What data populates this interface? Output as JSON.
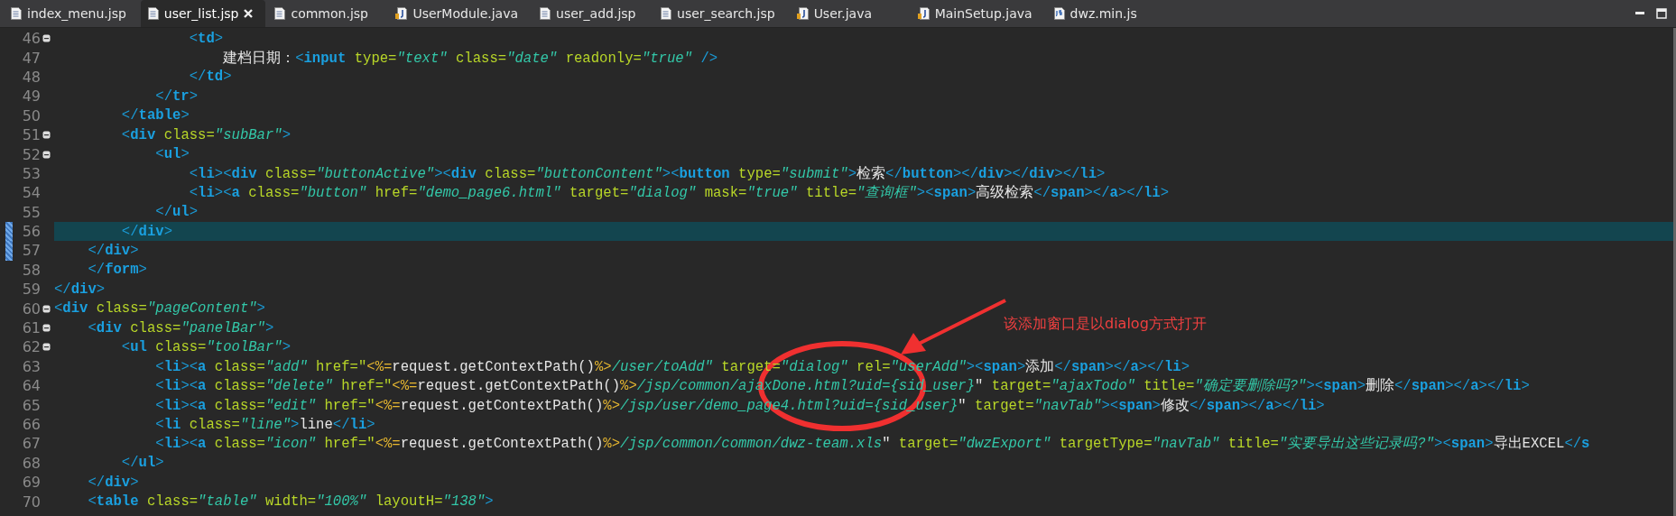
{
  "tabs": [
    {
      "label": "index_menu.jsp",
      "kind": "jsp",
      "selected": false
    },
    {
      "label": "user_list.jsp",
      "kind": "jsp",
      "selected": true
    },
    {
      "label": "common.jsp",
      "kind": "jsp",
      "selected": false
    },
    {
      "label": "UserModule.java",
      "kind": "java",
      "selected": false
    },
    {
      "label": "user_add.jsp",
      "kind": "jsp",
      "selected": false
    },
    {
      "label": "user_search.jsp",
      "kind": "jsp",
      "selected": false
    },
    {
      "label": "User.java",
      "kind": "java",
      "selected": false
    },
    {
      "label": "MainSetup.java",
      "kind": "java",
      "selected": false
    },
    {
      "label": "dwz.min.js",
      "kind": "js",
      "selected": false
    }
  ],
  "lines": [
    {
      "number": "46",
      "foldable": true,
      "current": false,
      "changed": false,
      "tokens": [
        {
          "kind": "p",
          "text": "                <"
        },
        {
          "kind": "t",
          "text": "td"
        },
        {
          "kind": "p",
          "text": ">"
        }
      ]
    },
    {
      "number": "47",
      "foldable": false,
      "current": false,
      "changed": false,
      "tokens": [
        {
          "kind": "x",
          "text": "                    建档日期："
        },
        {
          "kind": "p",
          "text": "<"
        },
        {
          "kind": "t",
          "text": "input"
        },
        {
          "kind": "a",
          "text": " type="
        },
        {
          "kind": "s",
          "text": "\"text\""
        },
        {
          "kind": "a",
          "text": " class="
        },
        {
          "kind": "s",
          "text": "\"date\""
        },
        {
          "kind": "a",
          "text": " readonly="
        },
        {
          "kind": "s",
          "text": "\"true\""
        },
        {
          "kind": "p",
          "text": " />"
        }
      ]
    },
    {
      "number": "48",
      "foldable": false,
      "current": false,
      "changed": false,
      "tokens": [
        {
          "kind": "p",
          "text": "                </"
        },
        {
          "kind": "t",
          "text": "td"
        },
        {
          "kind": "p",
          "text": ">"
        }
      ]
    },
    {
      "number": "49",
      "foldable": false,
      "current": false,
      "changed": false,
      "tokens": [
        {
          "kind": "p",
          "text": "            </"
        },
        {
          "kind": "t",
          "text": "tr"
        },
        {
          "kind": "p",
          "text": ">"
        }
      ]
    },
    {
      "number": "50",
      "foldable": false,
      "current": false,
      "changed": false,
      "tokens": [
        {
          "kind": "p",
          "text": "        </"
        },
        {
          "kind": "t",
          "text": "table"
        },
        {
          "kind": "p",
          "text": ">"
        }
      ]
    },
    {
      "number": "51",
      "foldable": true,
      "current": false,
      "changed": false,
      "tokens": [
        {
          "kind": "p",
          "text": "        <"
        },
        {
          "kind": "t",
          "text": "div"
        },
        {
          "kind": "a",
          "text": " class="
        },
        {
          "kind": "s",
          "text": "\"subBar\""
        },
        {
          "kind": "p",
          "text": ">"
        }
      ]
    },
    {
      "number": "52",
      "foldable": true,
      "current": false,
      "changed": false,
      "tokens": [
        {
          "kind": "p",
          "text": "            <"
        },
        {
          "kind": "t",
          "text": "ul"
        },
        {
          "kind": "p",
          "text": ">"
        }
      ]
    },
    {
      "number": "53",
      "foldable": false,
      "current": false,
      "changed": false,
      "tokens": [
        {
          "kind": "p",
          "text": "                <"
        },
        {
          "kind": "t",
          "text": "li"
        },
        {
          "kind": "p",
          "text": "><"
        },
        {
          "kind": "t",
          "text": "div"
        },
        {
          "kind": "a",
          "text": " class="
        },
        {
          "kind": "s",
          "text": "\"buttonActive\""
        },
        {
          "kind": "p",
          "text": "><"
        },
        {
          "kind": "t",
          "text": "div"
        },
        {
          "kind": "a",
          "text": " class="
        },
        {
          "kind": "s",
          "text": "\"buttonContent\""
        },
        {
          "kind": "p",
          "text": "><"
        },
        {
          "kind": "t",
          "text": "button"
        },
        {
          "kind": "a",
          "text": " type="
        },
        {
          "kind": "s",
          "text": "\"submit\""
        },
        {
          "kind": "p",
          "text": ">"
        },
        {
          "kind": "x",
          "text": "检索"
        },
        {
          "kind": "p",
          "text": "</"
        },
        {
          "kind": "t",
          "text": "button"
        },
        {
          "kind": "p",
          "text": "></"
        },
        {
          "kind": "t",
          "text": "div"
        },
        {
          "kind": "p",
          "text": "></"
        },
        {
          "kind": "t",
          "text": "div"
        },
        {
          "kind": "p",
          "text": "></"
        },
        {
          "kind": "t",
          "text": "li"
        },
        {
          "kind": "p",
          "text": ">"
        }
      ]
    },
    {
      "number": "54",
      "foldable": false,
      "current": false,
      "changed": false,
      "tokens": [
        {
          "kind": "p",
          "text": "                <"
        },
        {
          "kind": "t",
          "text": "li"
        },
        {
          "kind": "p",
          "text": "><"
        },
        {
          "kind": "t",
          "text": "a"
        },
        {
          "kind": "a",
          "text": " class="
        },
        {
          "kind": "s",
          "text": "\"button\""
        },
        {
          "kind": "a",
          "text": " href="
        },
        {
          "kind": "s",
          "text": "\"demo_page6.html\""
        },
        {
          "kind": "a",
          "text": " target="
        },
        {
          "kind": "s",
          "text": "\"dialog\""
        },
        {
          "kind": "a",
          "text": " mask="
        },
        {
          "kind": "s",
          "text": "\"true\""
        },
        {
          "kind": "a",
          "text": " title="
        },
        {
          "kind": "s",
          "text": "\"查询框\""
        },
        {
          "kind": "p",
          "text": "><"
        },
        {
          "kind": "t",
          "text": "span"
        },
        {
          "kind": "p",
          "text": ">"
        },
        {
          "kind": "x",
          "text": "高级检索"
        },
        {
          "kind": "p",
          "text": "</"
        },
        {
          "kind": "t",
          "text": "span"
        },
        {
          "kind": "p",
          "text": "></"
        },
        {
          "kind": "t",
          "text": "a"
        },
        {
          "kind": "p",
          "text": "></"
        },
        {
          "kind": "t",
          "text": "li"
        },
        {
          "kind": "p",
          "text": ">"
        }
      ]
    },
    {
      "number": "55",
      "foldable": false,
      "current": false,
      "changed": false,
      "tokens": [
        {
          "kind": "p",
          "text": "            </"
        },
        {
          "kind": "t",
          "text": "ul"
        },
        {
          "kind": "p",
          "text": ">"
        }
      ]
    },
    {
      "number": "56",
      "foldable": false,
      "current": true,
      "changed": true,
      "tokens": [
        {
          "kind": "p",
          "text": "        </"
        },
        {
          "kind": "t",
          "text": "div"
        },
        {
          "kind": "p",
          "text": ">"
        }
      ]
    },
    {
      "number": "57",
      "foldable": false,
      "current": false,
      "changed": true,
      "tokens": [
        {
          "kind": "p",
          "text": "    </"
        },
        {
          "kind": "t",
          "text": "div"
        },
        {
          "kind": "p",
          "text": ">"
        }
      ]
    },
    {
      "number": "58",
      "foldable": false,
      "current": false,
      "changed": false,
      "tokens": [
        {
          "kind": "p",
          "text": "    </"
        },
        {
          "kind": "t",
          "text": "form"
        },
        {
          "kind": "p",
          "text": ">"
        }
      ]
    },
    {
      "number": "59",
      "foldable": false,
      "current": false,
      "changed": false,
      "tokens": [
        {
          "kind": "p",
          "text": "</"
        },
        {
          "kind": "t",
          "text": "div"
        },
        {
          "kind": "p",
          "text": ">"
        }
      ]
    },
    {
      "number": "60",
      "foldable": true,
      "current": false,
      "changed": false,
      "tokens": [
        {
          "kind": "p",
          "text": "<"
        },
        {
          "kind": "t",
          "text": "div"
        },
        {
          "kind": "a",
          "text": " class="
        },
        {
          "kind": "s",
          "text": "\"pageContent\""
        },
        {
          "kind": "p",
          "text": ">"
        }
      ]
    },
    {
      "number": "61",
      "foldable": true,
      "current": false,
      "changed": false,
      "tokens": [
        {
          "kind": "p",
          "text": "    <"
        },
        {
          "kind": "t",
          "text": "div"
        },
        {
          "kind": "a",
          "text": " class="
        },
        {
          "kind": "s",
          "text": "\"panelBar\""
        },
        {
          "kind": "p",
          "text": ">"
        }
      ]
    },
    {
      "number": "62",
      "foldable": true,
      "current": false,
      "changed": false,
      "tokens": [
        {
          "kind": "p",
          "text": "        <"
        },
        {
          "kind": "t",
          "text": "ul"
        },
        {
          "kind": "a",
          "text": " class="
        },
        {
          "kind": "s",
          "text": "\"toolBar\""
        },
        {
          "kind": "p",
          "text": ">"
        }
      ]
    },
    {
      "number": "63",
      "foldable": false,
      "current": false,
      "changed": false,
      "tokens": [
        {
          "kind": "p",
          "text": "            <"
        },
        {
          "kind": "t",
          "text": "li"
        },
        {
          "kind": "p",
          "text": "><"
        },
        {
          "kind": "t",
          "text": "a"
        },
        {
          "kind": "a",
          "text": " class="
        },
        {
          "kind": "s",
          "text": "\"add\""
        },
        {
          "kind": "a",
          "text": " href=\""
        },
        {
          "kind": "j",
          "text": "<%="
        },
        {
          "kind": "x",
          "text": "request.getContextPath()"
        },
        {
          "kind": "j",
          "text": "%>"
        },
        {
          "kind": "s",
          "text": "/user/toAdd\""
        },
        {
          "kind": "a",
          "text": " target="
        },
        {
          "kind": "s",
          "text": "\"dialog\""
        },
        {
          "kind": "a",
          "text": " rel="
        },
        {
          "kind": "s",
          "text": "\"userAdd\""
        },
        {
          "kind": "p",
          "text": "><"
        },
        {
          "kind": "t",
          "text": "span"
        },
        {
          "kind": "p",
          "text": ">"
        },
        {
          "kind": "x",
          "text": "添加"
        },
        {
          "kind": "p",
          "text": "</"
        },
        {
          "kind": "t",
          "text": "span"
        },
        {
          "kind": "p",
          "text": "></"
        },
        {
          "kind": "t",
          "text": "a"
        },
        {
          "kind": "p",
          "text": "></"
        },
        {
          "kind": "t",
          "text": "li"
        },
        {
          "kind": "p",
          "text": ">"
        }
      ]
    },
    {
      "number": "64",
      "foldable": false,
      "current": false,
      "changed": false,
      "tokens": [
        {
          "kind": "p",
          "text": "            <"
        },
        {
          "kind": "t",
          "text": "li"
        },
        {
          "kind": "p",
          "text": "><"
        },
        {
          "kind": "t",
          "text": "a"
        },
        {
          "kind": "a",
          "text": " class="
        },
        {
          "kind": "s",
          "text": "\"delete\""
        },
        {
          "kind": "a",
          "text": " href=\""
        },
        {
          "kind": "j",
          "text": "<%="
        },
        {
          "kind": "x",
          "text": "request.getContextPath()"
        },
        {
          "kind": "j",
          "text": "%>"
        },
        {
          "kind": "s",
          "text": "/jsp/common/ajaxDone.html?uid={sid_user}"
        },
        {
          "kind": "x",
          "text": "\""
        },
        {
          "kind": "a",
          "text": " target="
        },
        {
          "kind": "s",
          "text": "\"ajaxTodo\""
        },
        {
          "kind": "a",
          "text": " title="
        },
        {
          "kind": "s",
          "text": "\"确定要删除吗?\""
        },
        {
          "kind": "p",
          "text": "><"
        },
        {
          "kind": "t",
          "text": "span"
        },
        {
          "kind": "p",
          "text": ">"
        },
        {
          "kind": "x",
          "text": "删除"
        },
        {
          "kind": "p",
          "text": "</"
        },
        {
          "kind": "t",
          "text": "span"
        },
        {
          "kind": "p",
          "text": "></"
        },
        {
          "kind": "t",
          "text": "a"
        },
        {
          "kind": "p",
          "text": "></"
        },
        {
          "kind": "t",
          "text": "li"
        },
        {
          "kind": "p",
          "text": ">"
        }
      ]
    },
    {
      "number": "65",
      "foldable": false,
      "current": false,
      "changed": false,
      "tokens": [
        {
          "kind": "p",
          "text": "            <"
        },
        {
          "kind": "t",
          "text": "li"
        },
        {
          "kind": "p",
          "text": "><"
        },
        {
          "kind": "t",
          "text": "a"
        },
        {
          "kind": "a",
          "text": " class="
        },
        {
          "kind": "s",
          "text": "\"edit\""
        },
        {
          "kind": "a",
          "text": " href=\""
        },
        {
          "kind": "j",
          "text": "<%="
        },
        {
          "kind": "x",
          "text": "request.getContextPath()"
        },
        {
          "kind": "j",
          "text": "%>"
        },
        {
          "kind": "s",
          "text": "/jsp/user/demo_page4.html?uid={sid_user}"
        },
        {
          "kind": "x",
          "text": "\""
        },
        {
          "kind": "a",
          "text": " target="
        },
        {
          "kind": "s",
          "text": "\"navTab\""
        },
        {
          "kind": "p",
          "text": "><"
        },
        {
          "kind": "t",
          "text": "span"
        },
        {
          "kind": "p",
          "text": ">"
        },
        {
          "kind": "x",
          "text": "修改"
        },
        {
          "kind": "p",
          "text": "</"
        },
        {
          "kind": "t",
          "text": "span"
        },
        {
          "kind": "p",
          "text": "></"
        },
        {
          "kind": "t",
          "text": "a"
        },
        {
          "kind": "p",
          "text": "></"
        },
        {
          "kind": "t",
          "text": "li"
        },
        {
          "kind": "p",
          "text": ">"
        }
      ]
    },
    {
      "number": "66",
      "foldable": false,
      "current": false,
      "changed": false,
      "tokens": [
        {
          "kind": "p",
          "text": "            <"
        },
        {
          "kind": "t",
          "text": "li"
        },
        {
          "kind": "a",
          "text": " class="
        },
        {
          "kind": "s",
          "text": "\"line\""
        },
        {
          "kind": "p",
          "text": ">"
        },
        {
          "kind": "x",
          "text": "line"
        },
        {
          "kind": "p",
          "text": "</"
        },
        {
          "kind": "t",
          "text": "li"
        },
        {
          "kind": "p",
          "text": ">"
        }
      ]
    },
    {
      "number": "67",
      "foldable": false,
      "current": false,
      "changed": false,
      "tokens": [
        {
          "kind": "p",
          "text": "            <"
        },
        {
          "kind": "t",
          "text": "li"
        },
        {
          "kind": "p",
          "text": "><"
        },
        {
          "kind": "t",
          "text": "a"
        },
        {
          "kind": "a",
          "text": " class="
        },
        {
          "kind": "s",
          "text": "\"icon\""
        },
        {
          "kind": "a",
          "text": " href=\""
        },
        {
          "kind": "j",
          "text": "<%="
        },
        {
          "kind": "x",
          "text": "request.getContextPath()"
        },
        {
          "kind": "j",
          "text": "%>"
        },
        {
          "kind": "s",
          "text": "/jsp/common/common/dwz-team.xls"
        },
        {
          "kind": "x",
          "text": "\""
        },
        {
          "kind": "a",
          "text": " target="
        },
        {
          "kind": "s",
          "text": "\"dwzExport\""
        },
        {
          "kind": "a",
          "text": " targetType="
        },
        {
          "kind": "s",
          "text": "\"navTab\""
        },
        {
          "kind": "a",
          "text": " title="
        },
        {
          "kind": "s",
          "text": "\"实要导出这些记录吗?\""
        },
        {
          "kind": "p",
          "text": "><"
        },
        {
          "kind": "t",
          "text": "span"
        },
        {
          "kind": "p",
          "text": ">"
        },
        {
          "kind": "x",
          "text": "导出EXCEL"
        },
        {
          "kind": "p",
          "text": "</"
        },
        {
          "kind": "t",
          "text": "s"
        }
      ]
    },
    {
      "number": "68",
      "foldable": false,
      "current": false,
      "changed": false,
      "tokens": [
        {
          "kind": "p",
          "text": "        </"
        },
        {
          "kind": "t",
          "text": "ul"
        },
        {
          "kind": "p",
          "text": ">"
        }
      ]
    },
    {
      "number": "69",
      "foldable": false,
      "current": false,
      "changed": false,
      "tokens": [
        {
          "kind": "p",
          "text": "    </"
        },
        {
          "kind": "t",
          "text": "div"
        },
        {
          "kind": "p",
          "text": ">"
        }
      ]
    },
    {
      "number": "70",
      "foldable": false,
      "current": false,
      "changed": false,
      "tokens": [
        {
          "kind": "p",
          "text": "    <"
        },
        {
          "kind": "t",
          "text": "table"
        },
        {
          "kind": "a",
          "text": " class="
        },
        {
          "kind": "s",
          "text": "\"table\""
        },
        {
          "kind": "a",
          "text": " width="
        },
        {
          "kind": "s",
          "text": "\"100%\""
        },
        {
          "kind": "a",
          "text": " layoutH="
        },
        {
          "kind": "s",
          "text": "\"138\""
        },
        {
          "kind": "p",
          "text": ">"
        }
      ]
    }
  ],
  "annotation": {
    "text": "该添加窗口是以dialog方式打开"
  }
}
